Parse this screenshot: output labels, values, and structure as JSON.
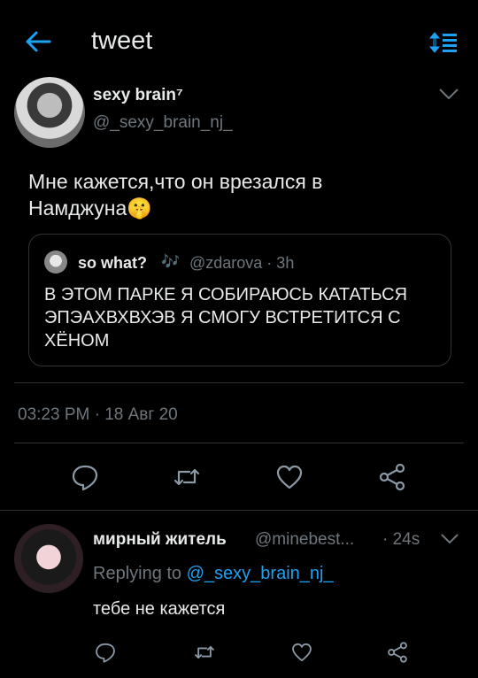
{
  "header": {
    "title": "tweet",
    "back_icon": "arrow-left-icon",
    "sort_icon": "sort-icon"
  },
  "tweet": {
    "author_name": "sexy brain⁷",
    "author_handle": "@_sexy_brain_nj_",
    "text": "Мне кажется,что он врезался в Намджуна🤫",
    "quote": {
      "name": "so what?",
      "note_emoji": "🎶",
      "handle_time": "@zdarova · 3h",
      "text": "В ЭТОМ ПАРКЕ Я СОБИРАЮСЬ КАТАТЬСЯ ЭПЭАХВХВХЭВ Я СМОГУ ВСТРЕТИТСЯ С ХЁНОМ"
    },
    "timestamp": "03:23 PM · 18 Авг 20"
  },
  "reply": {
    "name": "мирный житель",
    "handle": "@minebest...",
    "time": "· 24s",
    "replying_prefix": "Replying to",
    "replying_handle": "@_sexy_brain_nj_",
    "text": "тебе не кажется"
  },
  "colors": {
    "background": "#000000",
    "text": "#e7e9ea",
    "muted": "#6e767d",
    "accent": "#1da1f2",
    "divider": "#2f3336"
  }
}
